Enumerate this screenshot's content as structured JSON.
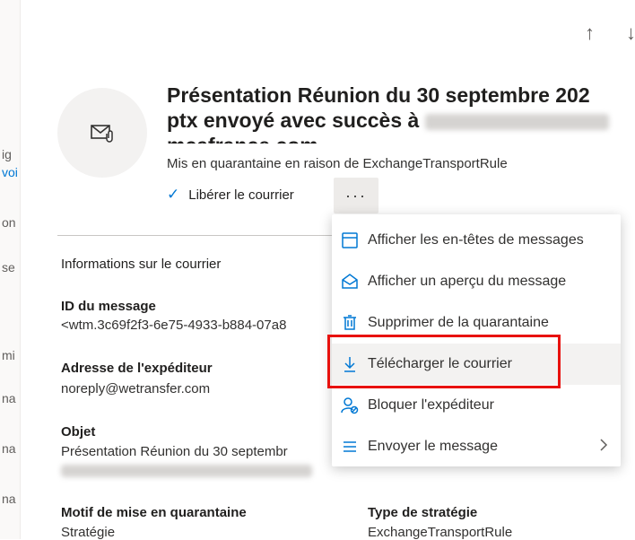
{
  "left_fragments": [
    "ig",
    "voi",
    "on",
    "se",
    "mi",
    "na",
    "na",
    "na"
  ],
  "nav": {
    "up": "↑",
    "down": "↓"
  },
  "header": {
    "title_line1": "Présentation Réunion du 30 septembre 202",
    "title_line2": "ptx envoyé avec succès à",
    "title_line3": "mcafrance.com",
    "subtitle": "Mis en quarantaine en raison de ExchangeTransportRule"
  },
  "actions": {
    "release_label": "Libérer le courrier",
    "more_label": "···"
  },
  "details": {
    "section_title": "Informations sur le courrier",
    "message_id_label": "ID du message",
    "message_id_value": "<wtm.3c69f2f3-6e75-4933-b884-07a8",
    "sender_label": "Adresse de l'expéditeur",
    "sender_value": "noreply@wetransfer.com",
    "subject_label": "Objet",
    "subject_value": "Présentation Réunion du 30 septembr",
    "reason_label": "Motif de mise en quarantaine",
    "reason_value": "Stratégie",
    "policy_label": "Type de stratégie",
    "policy_value": "ExchangeTransportRule"
  },
  "menu": {
    "items": [
      {
        "label": "Afficher les en-têtes de messages",
        "icon": "header-icon"
      },
      {
        "label": "Afficher un aperçu du message",
        "icon": "envelope-open-icon"
      },
      {
        "label": "Supprimer de la quarantaine",
        "icon": "trash-icon"
      },
      {
        "label": "Télécharger le courrier",
        "icon": "download-icon"
      },
      {
        "label": "Bloquer l'expéditeur",
        "icon": "block-user-icon"
      },
      {
        "label": "Envoyer le message",
        "icon": "lines-icon"
      }
    ]
  },
  "colors": {
    "accent": "#0078d4",
    "highlight_box": "#e8110e"
  }
}
